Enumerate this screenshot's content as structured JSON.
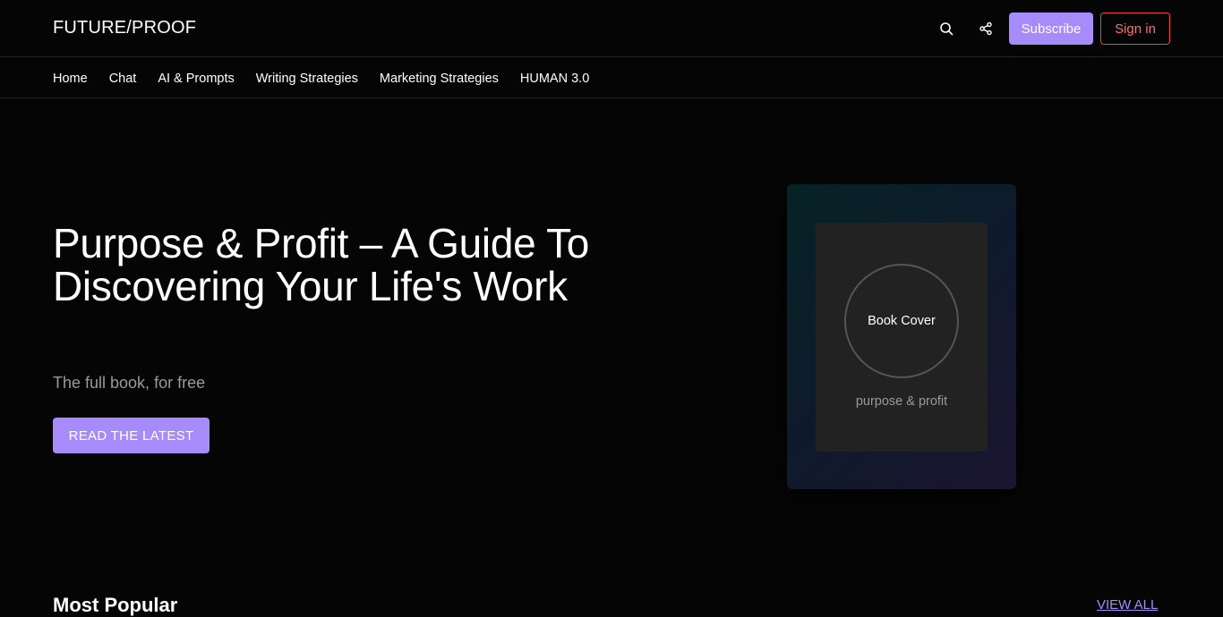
{
  "header": {
    "logo": "FUTURE/PROOF",
    "search_icon": "search-icon",
    "share_icon": "share-icon",
    "subscribe_label": "Subscribe",
    "signin_label": "Sign in"
  },
  "nav": {
    "items": [
      {
        "label": "Home"
      },
      {
        "label": "Chat"
      },
      {
        "label": "AI & Prompts"
      },
      {
        "label": "Writing Strategies"
      },
      {
        "label": "Marketing Strategies"
      },
      {
        "label": "HUMAN 3.0"
      }
    ]
  },
  "hero": {
    "title": "Purpose & Profit – A Guide To Discovering Your Life's Work",
    "subtitle": "The full book, for free",
    "cta_label": "READ THE LATEST",
    "book": {
      "circle_label": "Book Cover",
      "caption": "purpose & profit"
    }
  },
  "popular": {
    "title": "Most Popular",
    "view_all_label": "VIEW ALL"
  },
  "colors": {
    "accent": "#a78bfa",
    "signin": "#ef4444",
    "background": "#050505"
  }
}
